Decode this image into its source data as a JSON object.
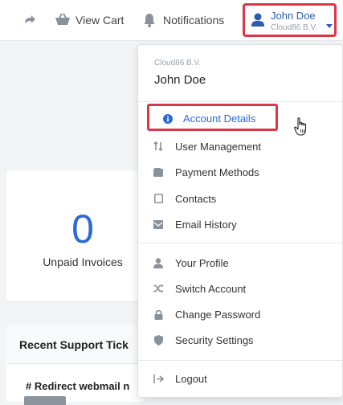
{
  "topbar": {
    "forward_icon": "arrow-right-icon",
    "cart": {
      "icon": "basket-icon",
      "label": "View Cart"
    },
    "notifications": {
      "icon": "bell-icon",
      "label": "Notifications"
    },
    "user": {
      "icon": "user-icon",
      "name": "John Doe",
      "company": "Cloud86 B.V.",
      "caret": "caret-down-icon"
    }
  },
  "left": {
    "invoices": {
      "count": "0",
      "label": "Unpaid Invoices"
    },
    "tickets": {
      "title": "Recent Support Tick",
      "ticket_subject": "# Redirect webmail n"
    }
  },
  "dropdown": {
    "company": "Cloud86 B.V.",
    "name": "John Doe",
    "account_items": [
      {
        "label": "Account Details",
        "icon": "info-circle-icon",
        "active": true
      },
      {
        "label": "User Management",
        "icon": "sort-arrows-icon"
      },
      {
        "label": "Payment Methods",
        "icon": "wallet-icon"
      },
      {
        "label": "Contacts",
        "icon": "contact-card-icon"
      },
      {
        "label": "Email History",
        "icon": "envelope-icon"
      }
    ],
    "profile_items": [
      {
        "label": "Your Profile",
        "icon": "user-icon"
      },
      {
        "label": "Switch Account",
        "icon": "shuffle-icon"
      },
      {
        "label": "Change Password",
        "icon": "lock-icon"
      },
      {
        "label": "Security Settings",
        "icon": "shield-icon"
      }
    ],
    "logout": {
      "label": "Logout",
      "icon": "logout-icon"
    }
  },
  "colors": {
    "accent": "#2a6bd6",
    "highlight": "#dc3545",
    "icon": "#8a9199"
  }
}
